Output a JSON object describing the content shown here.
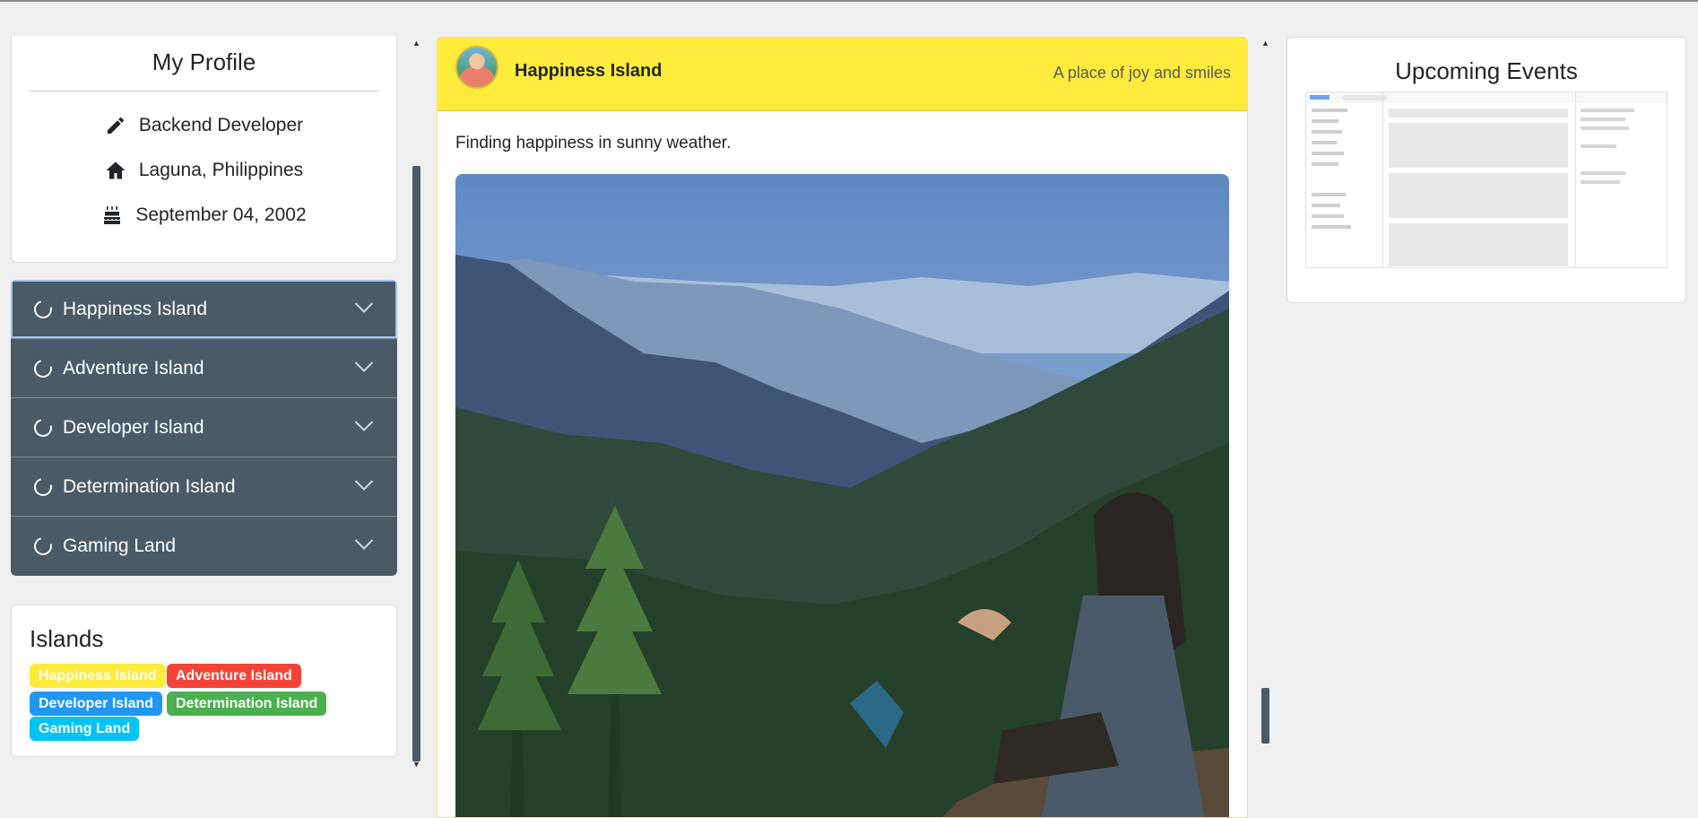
{
  "profile": {
    "title": "My Profile",
    "occupation": "Backend Developer",
    "location": "Laguna, Philippines",
    "birthday": "September 04, 2002"
  },
  "accordion": {
    "items": [
      {
        "label": "Happiness Island",
        "icon": "spinner-icon",
        "active": true
      },
      {
        "label": "Adventure Island",
        "icon": "spinner-icon"
      },
      {
        "label": "Developer Island",
        "icon": "spinner-icon"
      },
      {
        "label": "Determination Island",
        "icon": "spinner-icon"
      },
      {
        "label": "Gaming Land",
        "icon": "spinner-icon"
      }
    ]
  },
  "islands": {
    "title": "Islands",
    "badges": [
      {
        "label": "Happiness Island",
        "color": "#ffeb3b"
      },
      {
        "label": "Adventure Island",
        "color": "#f44336"
      },
      {
        "label": "Developer Island",
        "color": "#2196f3"
      },
      {
        "label": "Determination Island",
        "color": "#4caf50"
      },
      {
        "label": "Gaming Land",
        "color": "#03c3f4"
      }
    ]
  },
  "post": {
    "island_name": "Happiness Island",
    "tagline": "A place of joy and smiles",
    "caption": "Finding happiness in sunny weather.",
    "header_color": "#ffeb3b"
  },
  "events": {
    "title": "Upcoming Events"
  },
  "colors": {
    "accordion_bg": "#4a5a66",
    "accent_yellow": "#ffeb3b"
  }
}
